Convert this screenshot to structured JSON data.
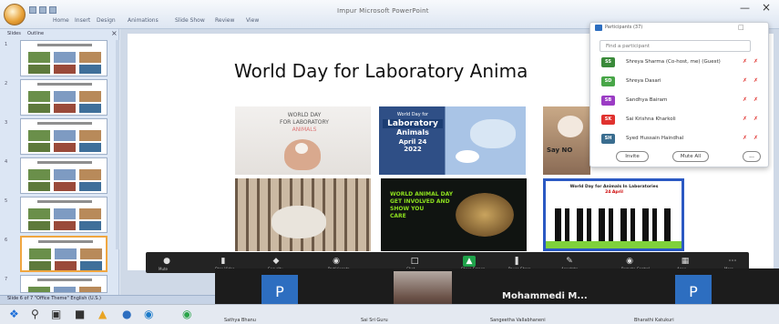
{
  "app": {
    "window_title": "Impur Microsoft PowerPoint",
    "menu": [
      "Home",
      "Insert",
      "Design",
      "Animations",
      "Slide Show",
      "Review",
      "View"
    ],
    "pane_tabs": [
      "Slides",
      "Outline"
    ]
  },
  "slides_pane": {
    "thumbnails": [
      {
        "num": "1",
        "selected": false
      },
      {
        "num": "2",
        "selected": false
      },
      {
        "num": "3",
        "selected": false
      },
      {
        "num": "4",
        "selected": false
      },
      {
        "num": "5",
        "selected": false
      },
      {
        "num": "6",
        "selected": true
      },
      {
        "num": "7",
        "selected": false
      }
    ]
  },
  "slide": {
    "title": "World Day for Laboratory Anima",
    "card1": {
      "line1": "WORLD DAY",
      "line2": "FOR LABORATORY",
      "line3": "ANIMALS"
    },
    "card2": {
      "line1": "World Day for",
      "line2": "Laboratory",
      "line3": "Animals",
      "date": "April 24",
      "year": "2022"
    },
    "card3": {
      "line1": "Say NO"
    },
    "card5": {
      "line1": "WORLD ANIMAL DAY",
      "line2": "GET INVOLVED AND",
      "line3": "SHOW YOU",
      "line4": "CARE"
    },
    "card6": {
      "line1": "World Day for Animals In Laboratories",
      "line2": "24 April"
    }
  },
  "participants": {
    "title": "Participants (37)",
    "search_placeholder": "Find a participant",
    "rows": [
      {
        "initials": "SS",
        "name": "Shreya Sharma (Co-host, me) (Guest)",
        "color": "#3a8a3a"
      },
      {
        "initials": "SD",
        "name": "Shreya Dasari",
        "color": "#48a648"
      },
      {
        "initials": "SB",
        "name": "Sandhya Bairam",
        "color": "#9b3cc4"
      },
      {
        "initials": "SK",
        "name": "Sai Krishna Kharkoli",
        "color": "#e0322f"
      },
      {
        "initials": "SH",
        "name": "Syed Hussain Haindhal",
        "color": "#3a6d8f"
      }
    ],
    "invite_label": "Invite",
    "mute_all_label": "Mute All",
    "more_label": "..."
  },
  "toolbar": {
    "items": [
      {
        "icon": "microphone-icon",
        "label": "Mute"
      },
      {
        "icon": "video-icon",
        "label": "Stop Video"
      },
      {
        "icon": "security-icon",
        "label": "Security"
      },
      {
        "icon": "participants-icon",
        "label": "Participants"
      },
      {
        "icon": "chat-icon",
        "label": "Chat"
      },
      {
        "icon": "share-icon",
        "label": "Share Screen"
      },
      {
        "icon": "pause-icon",
        "label": "Pause Share"
      },
      {
        "icon": "annotate-icon",
        "label": "Annotate"
      },
      {
        "icon": "remote-control-icon",
        "label": "Remote Control"
      },
      {
        "icon": "apps-icon",
        "label": "Apps"
      },
      {
        "icon": "more-icon",
        "label": "More"
      }
    ]
  },
  "video": {
    "tile1_letter": "P",
    "tile3_letter": "P",
    "name": "Mohammedi M...",
    "accent": "#2d6ec0"
  },
  "status_bar": {
    "text": "Slide 6 of 7   \"Office Theme\"   English (U.S.)"
  },
  "taskbar": {
    "labels": [
      "Sathya Bhanu",
      "Sai Sri Guru",
      "Sangeetha Vallabhaneni",
      "Bharathi Katukuri"
    ]
  }
}
